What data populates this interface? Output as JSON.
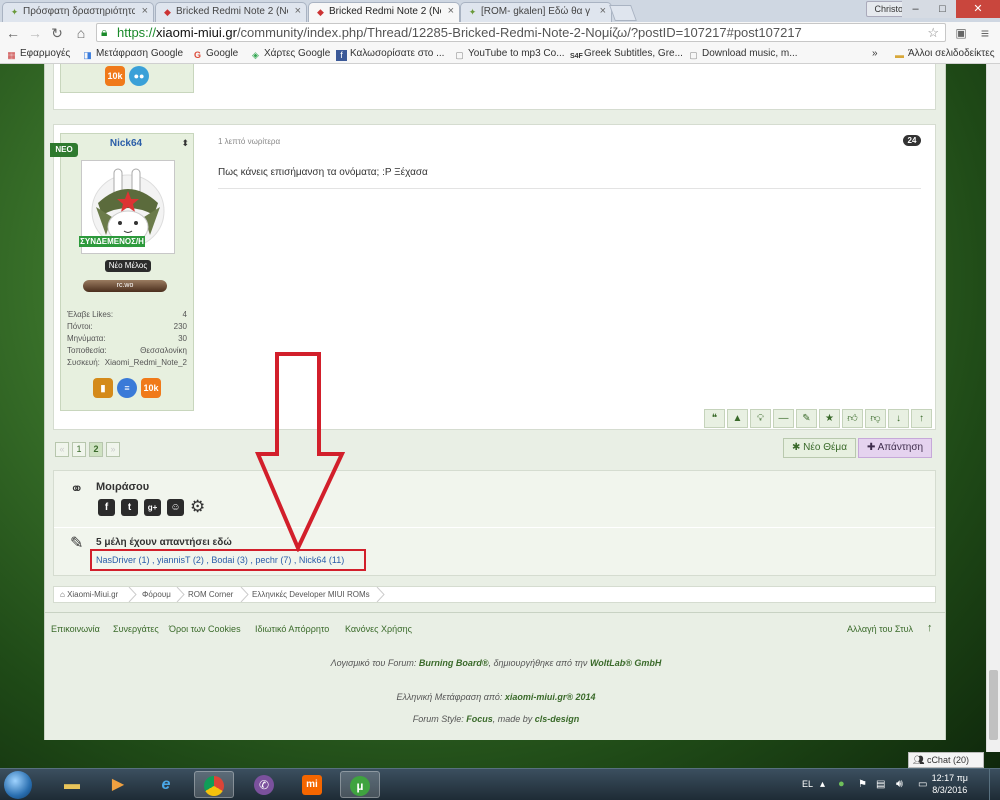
{
  "browser": {
    "tabs": [
      {
        "title": "Πρόσφατη δραστηριότητα"
      },
      {
        "title": "Bricked Redmi Note 2 (No"
      },
      {
        "title": "Bricked Redmi Note 2 (No"
      },
      {
        "title": "[ROM- gkalen] Εδώ θα γ"
      }
    ],
    "user_chip": "Christos",
    "url_scheme": "https://",
    "url_host": "xiaomi-miui.gr",
    "url_path": "/community/index.php/Thread/12285-Bricked-Redmi-Note-2-Νομίζω/?postID=107217#post107217",
    "bookmarks": [
      "Εφαρμογές",
      "Μετάφραση Google",
      "Google",
      "Χάρτες Google",
      "Καλωσορίσατε στο ...",
      "YouTube to mp3 Co...",
      "Greek Subtitles, Gre...",
      "Download music, m...",
      "Άλλοι σελιδοδείκτες"
    ]
  },
  "prev_post": {
    "badge": "10k"
  },
  "post": {
    "new_badge": "ΝΕΟ",
    "username": "Nick64",
    "online": "ΣΥΝΔΕΜΕΝΟΣ/Η",
    "rank": "Νέο Μέλος",
    "level_label": "rc.wo",
    "stats": [
      {
        "label": "Έλαβε Likes:",
        "value": "4"
      },
      {
        "label": "Πόντοι:",
        "value": "230"
      },
      {
        "label": "Μηνύματα:",
        "value": "30"
      },
      {
        "label": "Τοποθεσία:",
        "value": "Θεσσαλονίκη"
      },
      {
        "label": "Συσκευή:",
        "value": "Xiaomi_Redmi_Note_2"
      }
    ],
    "badge_10k": "10k",
    "time": "1 λεπτό νωρίτερα",
    "number": "24",
    "text": "Πως κάνεις επισήμανση τα ονόματα; :P Ξέχασα"
  },
  "pagination": {
    "prev": "«",
    "pages": [
      "1",
      "2"
    ],
    "next": "»"
  },
  "buttons": {
    "new_thread": "Νέο Θέμα",
    "reply": "Απάντηση"
  },
  "share": {
    "title": "Μοιράσου"
  },
  "repliers": {
    "title": "5 μέλη έχουν απαντήσει εδώ",
    "list": "NasDriver (1) , yiannisT (2) , Bodai (3) , pechr (7) , Nick64 (11)"
  },
  "breadcrumb": [
    "Xiaomi-Miui.gr",
    "Φόρουμ",
    "ROM Corner",
    "Ελληνικές Developer MIUI ROMs"
  ],
  "footer": {
    "links": [
      "Επικοινωνία",
      "Συνεργάτες",
      "Όροι των Cookies",
      "Ιδιωτικό Απόρρητο",
      "Κανόνες Χρήσης"
    ],
    "style": "Αλλαγή του Στυλ",
    "software_pre": "Λογισμικό του Forum: ",
    "software_name": "Burning Board®",
    "software_mid": ", δημιουργήθηκε από την ",
    "software_company": "WoltLab® GmbH",
    "translation_pre": "Ελληνική Μετάφραση από: ",
    "translation_name": "xiaomi-miui.gr® 2014",
    "style_pre": "Forum Style: ",
    "style_name": "Focus",
    "style_mid": ", made by ",
    "style_author": "cls-design"
  },
  "chat": "cChat (20)",
  "taskbar": {
    "lang": "EL",
    "time": "12:17 πμ",
    "date": "8/3/2016"
  },
  "colors": {
    "accent_green": "#3a6a2a",
    "highlight_red": "#d21f2b",
    "reply_purple": "#e5d3ef"
  }
}
